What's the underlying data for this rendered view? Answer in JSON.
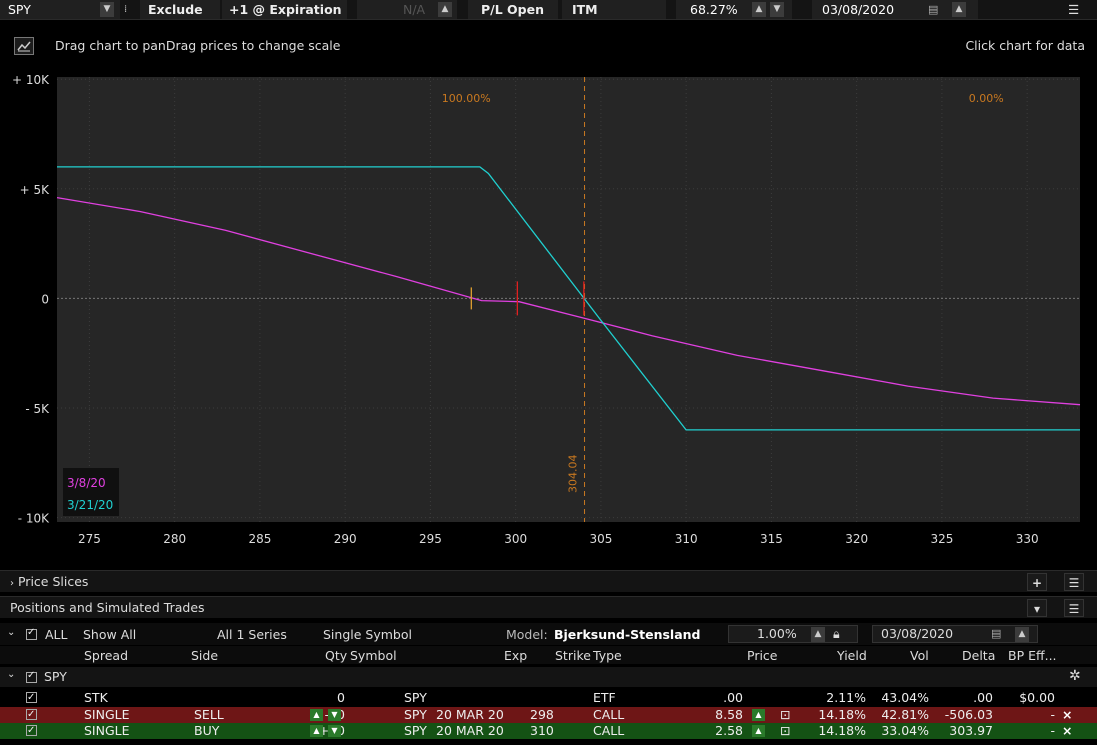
{
  "toolbar": {
    "symbol": "SPY",
    "exclude_label": "Exclude",
    "expiration_label": "+1 @ Expiration",
    "na_value": "N/A",
    "pl_open_label": "P/L Open",
    "itm_label": "ITM",
    "percent_value": "68.27%",
    "date_value": "03/08/2020"
  },
  "hints": {
    "left": "Drag chart to panDrag prices to change scale",
    "right": "Click chart for data"
  },
  "chart_data": {
    "type": "line",
    "title": "",
    "x_ticks": [
      275,
      280,
      285,
      290,
      295,
      300,
      305,
      310,
      315,
      320,
      325,
      330
    ],
    "y_ticks": [
      10000,
      5000,
      0,
      -5000,
      -10000
    ],
    "y_tick_labels": [
      "+ 10K",
      "+ 5K",
      "0",
      "- 5K",
      "- 10K"
    ],
    "xlim": [
      273.1,
      333.1
    ],
    "ylim": [
      -10200,
      10100
    ],
    "grid": true,
    "series": [
      {
        "name": "3/8/20",
        "color": "#e040e0",
        "x": [
          273.1,
          278,
          283,
          288,
          293,
          298,
          300.2,
          304,
          308,
          313,
          318,
          323,
          328,
          333.1
        ],
        "y": [
          4600,
          3960,
          3100,
          2050,
          1000,
          -100,
          -150,
          -900,
          -1700,
          -2600,
          -3300,
          -4000,
          -4550,
          -4850
        ]
      },
      {
        "name": "3/21/20",
        "color": "#20d0d0",
        "x": [
          273.1,
          297.9,
          298.4,
          304.9,
          310,
          333.1
        ],
        "y": [
          6000,
          6000,
          5700,
          -900,
          -6000,
          -6000
        ]
      }
    ],
    "annotations": [
      {
        "text": "100.00%",
        "x": 297.1,
        "y": 8950
      },
      {
        "text": "0.00%",
        "x": 327.6,
        "y": 8950
      },
      {
        "text": "304.04",
        "x": 304.04,
        "y": -8000
      }
    ],
    "vline_x": 304.04,
    "markers": [
      {
        "x": 297.4,
        "y": 0,
        "color": "#e0a030"
      },
      {
        "x": 300.1,
        "y": 0,
        "color": "#e02020"
      },
      {
        "x": 304.0,
        "y": 0,
        "color": "#e02020"
      }
    ],
    "legend_placement": "bottom-left",
    "colors": {
      "background": "#262626",
      "grid": "#3c3c3c",
      "annotation": "#c87820"
    }
  },
  "sections": {
    "price_slices": "Price Slices",
    "positions": "Positions and Simulated Trades"
  },
  "filters": {
    "all_label": "ALL",
    "show_all": "Show All",
    "series": "All 1 Series",
    "symbol_mode": "Single Symbol",
    "model_label": "Model:",
    "model_value": "Bjerksund-Stensland",
    "rate": "1.00%",
    "date": "03/08/2020"
  },
  "columns": {
    "spread": "Spread",
    "side": "Side",
    "qty": "Qty",
    "symbol": "Symbol",
    "exp": "Exp",
    "strike": "Strike",
    "type": "Type",
    "price": "Price",
    "yield": "Yield",
    "vol": "Vol",
    "delta": "Delta",
    "bp": "BP Eff..."
  },
  "group": {
    "label": "SPY"
  },
  "rows": [
    {
      "spread": "STK",
      "side": "",
      "qty": "0",
      "symbol": "SPY",
      "exp": "",
      "strike": "",
      "type": "ETF",
      "price": ".00",
      "yield": "2.11%",
      "vol": "43.04%",
      "delta": ".00",
      "bp": "$0.00",
      "bg": "#000000"
    },
    {
      "spread": "SINGLE",
      "side": "SELL",
      "qty": "-10",
      "symbol": "SPY",
      "exp": "20 MAR 20",
      "strike": "298",
      "type": "CALL",
      "price": "8.58",
      "yield": "14.18%",
      "vol": "42.81%",
      "delta": "-506.03",
      "bp": "-",
      "bg": "#6e1616"
    },
    {
      "spread": "SINGLE",
      "side": "BUY",
      "qty": "+10",
      "symbol": "SPY",
      "exp": "20 MAR 20",
      "strike": "310",
      "type": "CALL",
      "price": "2.58",
      "yield": "14.18%",
      "vol": "33.04%",
      "delta": "303.97",
      "bp": "-",
      "bg": "#145214"
    }
  ]
}
